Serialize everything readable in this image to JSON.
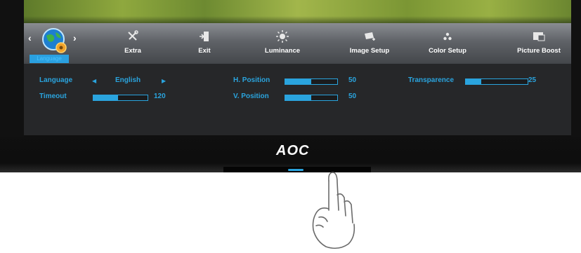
{
  "brand": {
    "logo_text": "AOC"
  },
  "menu": {
    "selected_label": "Language",
    "items": [
      {
        "label": "Extra",
        "icon": "tools-icon"
      },
      {
        "label": "Exit",
        "icon": "exit-icon"
      },
      {
        "label": "Luminance",
        "icon": "sun-icon"
      },
      {
        "label": "Image Setup",
        "icon": "image-setup-icon"
      },
      {
        "label": "Color Setup",
        "icon": "color-dots-icon"
      },
      {
        "label": "Picture Boost",
        "icon": "picture-boost-icon"
      }
    ]
  },
  "settings": {
    "language": {
      "label": "Language",
      "value": "English"
    },
    "timeout": {
      "label": "Timeout",
      "value": "120",
      "level_percent": 45
    },
    "h_position": {
      "label": "H. Position",
      "value": "50",
      "level_percent": 50
    },
    "v_position": {
      "label": "V. Position",
      "value": "50",
      "level_percent": 50
    },
    "transparence": {
      "label": "Transparence",
      "value": "25",
      "level_percent": 25
    }
  },
  "colors": {
    "accent": "#2aa4de",
    "panel": "#262729",
    "menubar": "#5f6267"
  }
}
